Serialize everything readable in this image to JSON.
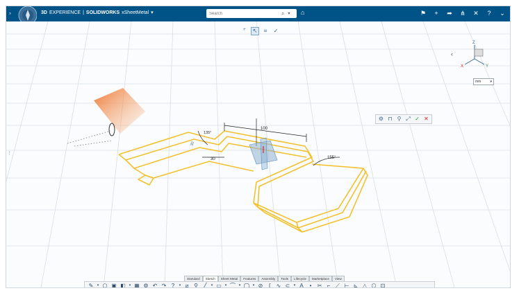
{
  "topbar": {
    "brand_3d": "3D",
    "brand_experience": "EXPERIENCE",
    "brand_sep": "|",
    "brand_app": "SOLIDWORKS",
    "brand_doc": "xSheetMetal",
    "search_placeholder": "Search",
    "colors": {
      "bar": "#005386",
      "text": "#ffffff"
    },
    "icons": [
      "search-icon",
      "chevron-down-icon",
      "tag-icon",
      "user-icon",
      "plus-icon",
      "share-icon",
      "network-icon",
      "tools-icon",
      "help-icon",
      "chevron-down-icon"
    ]
  },
  "viewport": {
    "units_label": "mm",
    "dimensions": {
      "width": "100",
      "left_gap": "30",
      "bend_angle_small": "135°",
      "bend_angle_large": "155°",
      "height": "30"
    },
    "axis_labels": {
      "x": "X",
      "y": "Y",
      "z": "Z"
    },
    "colors": {
      "sketch": "#f2c12e",
      "sketch_edge": "#c89a10",
      "plane": "#5f8fb8",
      "manipulator": "#ee6a1c",
      "grid": "#d7dde2"
    }
  },
  "tabs": [
    "Standard",
    "Sketch",
    "Sheet Metal",
    "Features",
    "Assembly",
    "Tools",
    "Lifecycle",
    "Marketplace",
    "View"
  ],
  "active_tab": "Sketch"
}
